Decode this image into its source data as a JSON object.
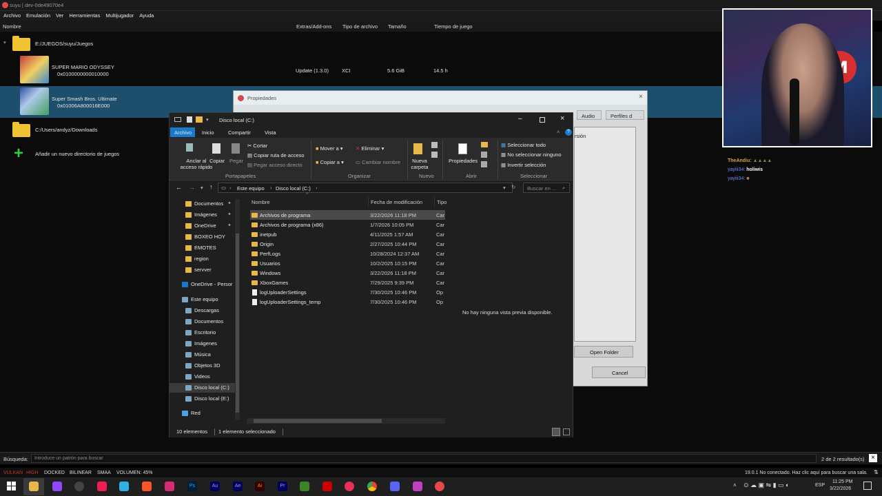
{
  "window": {
    "title": "suyu | dev-0de49070e4"
  },
  "menu": [
    "Archivo",
    "Emulación",
    "Ver",
    "Herramientas",
    "Multijugador",
    "Ayuda"
  ],
  "columns": {
    "name": "Nombre",
    "addons": "Extras/Add-ons",
    "filetype": "Tipo de archivo",
    "size": "Tamaño",
    "playtime": "Tiempo de juego"
  },
  "gamelist": {
    "dir1": "E:/JUEGOS/suyu/Juegos",
    "games": [
      {
        "title": "SUPER MARIO ODYSSEY",
        "id": "0x0100000000010000",
        "addons": "Update (1.3.0)",
        "filetype": "XCI",
        "size": "5.6 GiB",
        "playtime": "14.5 h"
      },
      {
        "title": "Super Smash Bros. Ultimate",
        "id": "0x01006A800016E000",
        "addons": "",
        "filetype": "",
        "size": "",
        "playtime": ""
      }
    ],
    "dir2": "C:/Users/andyz/Downloads",
    "add_dir": "Añadir un nuevo directorio de juegos"
  },
  "properties": {
    "title": "Propiedades",
    "tabs_right": [
      "Audio",
      "Perfiles d"
    ],
    "version_label": "rsión",
    "open_folder": "Open Folder",
    "cancel": "Cancel"
  },
  "explorer": {
    "title": "Disco local (C:)",
    "ribbon_tabs": [
      "Archivo",
      "Inicio",
      "Compartir",
      "Vista"
    ],
    "ribbon": {
      "pin": "Anclar al acceso rápido",
      "copy": "Copiar",
      "paste": "Pegar",
      "cut": "Cortar",
      "copy_path": "Copiar ruta de acceso",
      "paste_shortcut": "Pegar acceso directo",
      "group_clipboard": "Portapapeles",
      "move_to": "Mover a",
      "copy_to": "Copiar a",
      "delete": "Eliminar",
      "rename": "Cambiar nombre",
      "group_organize": "Organizar",
      "new_folder": "Nueva carpeta",
      "group_new": "Nuevo",
      "properties": "Propiedades",
      "group_open": "Abrir",
      "select_all": "Seleccionar todo",
      "select_none": "No seleccionar ninguno",
      "invert_selection": "Invertir selección",
      "group_select": "Seleccionar"
    },
    "breadcrumb": [
      "Este equipo",
      "Disco local (C:)"
    ],
    "search_placeholder": "Buscar en ...",
    "nav": [
      {
        "label": "Documentos",
        "pinned": true
      },
      {
        "label": "Imágenes",
        "pinned": true
      },
      {
        "label": "OneDrive",
        "pinned": true
      },
      {
        "label": "BOXEO HOY"
      },
      {
        "label": "EMOTES"
      },
      {
        "label": "region"
      },
      {
        "label": "servver"
      },
      {
        "label": "OneDrive - Persor"
      },
      {
        "label": "Este equipo"
      },
      {
        "label": "Descargas"
      },
      {
        "label": "Documentos"
      },
      {
        "label": "Escritorio"
      },
      {
        "label": "Imágenes"
      },
      {
        "label": "Música"
      },
      {
        "label": "Objetos 3D"
      },
      {
        "label": "Videos"
      },
      {
        "label": "Disco local (C:)"
      },
      {
        "label": "Disco local (E:)"
      },
      {
        "label": "Red"
      }
    ],
    "col_name": "Nombre",
    "col_date": "Fecha de modificación",
    "col_type": "Tipo",
    "files": [
      {
        "name": "Archivos de programa",
        "date": "3/22/2026 11:18 PM",
        "type": "Car",
        "kind": "folder"
      },
      {
        "name": "Archivos de programa (x86)",
        "date": "1/7/2026 10:05 PM",
        "type": "Car",
        "kind": "folder"
      },
      {
        "name": "inetpub",
        "date": "4/11/2025 1:57 AM",
        "type": "Car",
        "kind": "folder"
      },
      {
        "name": "Origin",
        "date": "2/27/2025 10:44 PM",
        "type": "Car",
        "kind": "folder"
      },
      {
        "name": "PerfLogs",
        "date": "10/28/2024 12:37 AM",
        "type": "Car",
        "kind": "folder"
      },
      {
        "name": "Usuarios",
        "date": "10/2/2025 10:15 PM",
        "type": "Car",
        "kind": "folder"
      },
      {
        "name": "Windows",
        "date": "3/22/2026 11:18 PM",
        "type": "Car",
        "kind": "folder"
      },
      {
        "name": "XboxGames",
        "date": "7/29/2025 9:39 PM",
        "type": "Car",
        "kind": "folder"
      },
      {
        "name": "logUploaderSettings",
        "date": "7/30/2025 10:46 PM",
        "type": "Op",
        "kind": "file"
      },
      {
        "name": "logUploaderSettings_temp",
        "date": "7/30/2025 10:46 PM",
        "type": "Op",
        "kind": "file"
      }
    ],
    "preview": "No hay ninguna vista previa disponible.",
    "status_count": "10 elementos",
    "status_selected": "1 elemento seleccionado"
  },
  "chat": [
    {
      "user": "TheAndiu:",
      "msg": "",
      "color": "#d9a441"
    },
    {
      "user": "yayiii34:",
      "msg": "holiwis",
      "color": "#6b8cff"
    },
    {
      "user": "yayiii34:",
      "msg": "",
      "color": "#6b8cff"
    }
  ],
  "search": {
    "label": "Búsqueda:",
    "placeholder": "Introduce un patrón para buscar",
    "results": "2 de 2 resultado(s)"
  },
  "status": {
    "vulkan": "VULKAN",
    "high": "HIGH",
    "docked": "DOCKED",
    "filter": "BILINEAR",
    "aa": "SMAA",
    "volume": "VOLUMEN: 45%",
    "right": "19.0.1  No conectado. Haz clic aquí para buscar una sala."
  },
  "tray": {
    "lang": "ESP",
    "time": "11:25 PM",
    "date": "3/22/2026"
  },
  "colors": {
    "accent": "#0078d4",
    "selection": "#1d4e6b",
    "folder": "#f1c232"
  }
}
